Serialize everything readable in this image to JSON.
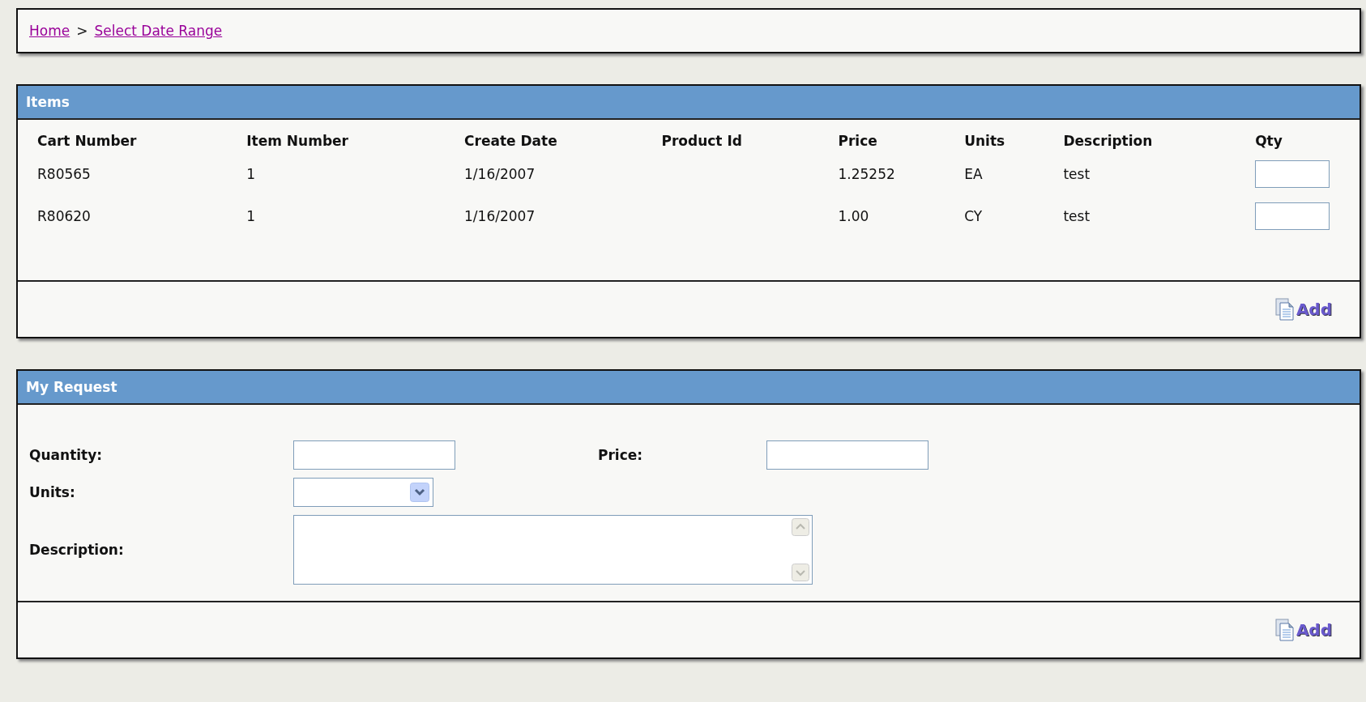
{
  "breadcrumb": [
    {
      "label": "Home"
    },
    {
      "label": "Select Date Range"
    }
  ],
  "breadcrumb_separator": ">",
  "items_panel": {
    "title": "Items",
    "columns": [
      "Cart Number",
      "Item Number",
      "Create Date",
      "Product Id",
      "Price",
      "Units",
      "Description",
      "Qty"
    ],
    "rows": [
      {
        "cells": [
          "R80565",
          "1",
          "1/16/2007",
          "",
          "1.25252",
          "EA",
          "test"
        ]
      },
      {
        "cells": [
          "R80620",
          "1",
          "1/16/2007",
          "",
          "1.00",
          "CY",
          "test"
        ]
      }
    ],
    "add_button": "Add"
  },
  "request_panel": {
    "title": "My Request",
    "quantity_label": "Quantity:",
    "price_label": "Price:",
    "units_label": "Units:",
    "description_label": "Description:",
    "add_button": "Add"
  }
}
